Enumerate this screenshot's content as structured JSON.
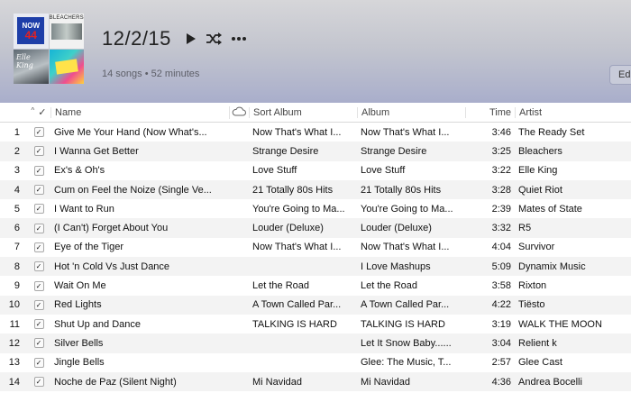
{
  "playlist": {
    "title": "12/2/15",
    "subtitle": "14 songs • 52 minutes",
    "edit_label": "Ed",
    "art_tile1_line1": "NOW",
    "art_tile1_line2": "44",
    "art_tile2_text": "BLEACHERS",
    "art_tile3_text": "Elle King"
  },
  "columns": {
    "sort_indicator": "^",
    "check": "✓",
    "name": "Name",
    "sort_album": "Sort Album",
    "album": "Album",
    "time": "Time",
    "artist": "Artist"
  },
  "tracks": [
    {
      "num": "1",
      "name": "Give Me Your Hand (Now What's...",
      "sort_album": "Now That's What I...",
      "album": "Now That's What I...",
      "time": "3:46",
      "artist": "The Ready Set"
    },
    {
      "num": "2",
      "name": "I Wanna Get Better",
      "sort_album": "Strange Desire",
      "album": "Strange Desire",
      "time": "3:25",
      "artist": "Bleachers"
    },
    {
      "num": "3",
      "name": "Ex's & Oh's",
      "sort_album": "Love Stuff",
      "album": "Love Stuff",
      "time": "3:22",
      "artist": "Elle King"
    },
    {
      "num": "4",
      "name": "Cum on Feel the Noize (Single Ve...",
      "sort_album": "21 Totally 80s Hits",
      "album": "21 Totally 80s Hits",
      "time": "3:28",
      "artist": "Quiet Riot"
    },
    {
      "num": "5",
      "name": "I Want to Run",
      "sort_album": "You're Going to Ma...",
      "album": "You're Going to Ma...",
      "time": "2:39",
      "artist": "Mates of State"
    },
    {
      "num": "6",
      "name": "(I Can't) Forget About You",
      "sort_album": "Louder (Deluxe)",
      "album": "Louder (Deluxe)",
      "time": "3:32",
      "artist": "R5"
    },
    {
      "num": "7",
      "name": "Eye of the Tiger",
      "sort_album": "Now That's What I...",
      "album": "Now That's What I...",
      "time": "4:04",
      "artist": "Survivor"
    },
    {
      "num": "8",
      "name": "Hot 'n Cold Vs Just Dance",
      "sort_album": "",
      "album": "I Love Mashups",
      "time": "5:09",
      "artist": "Dynamix Music"
    },
    {
      "num": "9",
      "name": "Wait On Me",
      "sort_album": "Let the Road",
      "album": "Let the Road",
      "time": "3:58",
      "artist": "Rixton"
    },
    {
      "num": "10",
      "name": "Red Lights",
      "sort_album": "A Town Called Par...",
      "album": "A Town Called Par...",
      "time": "4:22",
      "artist": "Tiësto"
    },
    {
      "num": "11",
      "name": "Shut Up and Dance",
      "sort_album": "TALKING IS HARD",
      "album": "TALKING IS HARD",
      "time": "3:19",
      "artist": "WALK THE MOON"
    },
    {
      "num": "12",
      "name": "Silver Bells",
      "sort_album": "",
      "album": "Let It Snow Baby......",
      "time": "3:04",
      "artist": "Relient k"
    },
    {
      "num": "13",
      "name": "Jingle Bells",
      "sort_album": "",
      "album": "Glee: The Music, T...",
      "time": "2:57",
      "artist": "Glee Cast"
    },
    {
      "num": "14",
      "name": "Noche de Paz (Silent Night)",
      "sort_album": "Mi Navidad",
      "album": "Mi Navidad",
      "time": "4:36",
      "artist": "Andrea Bocelli"
    }
  ],
  "icons": {
    "play": "play-icon",
    "shuffle": "shuffle-icon",
    "more": "more-icon",
    "cloud": "cloud-icon",
    "checkbox": "checkbox-icon"
  }
}
